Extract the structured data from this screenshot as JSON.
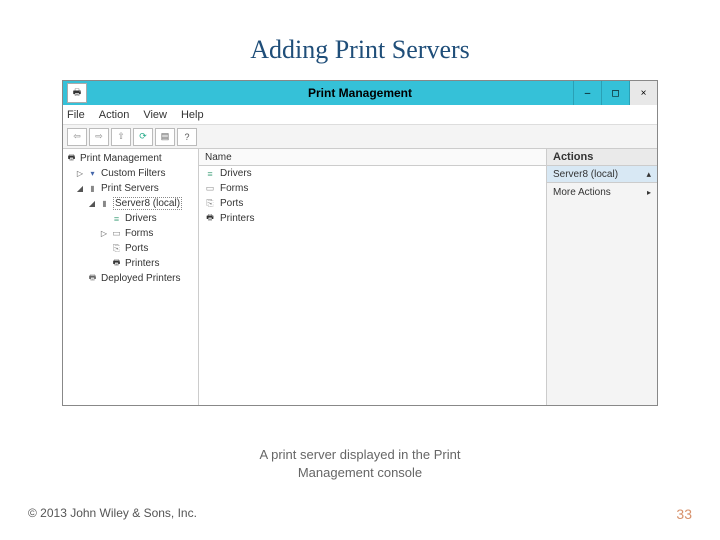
{
  "slide": {
    "title": "Adding Print Servers",
    "caption_line1": "A print server displayed in the Print",
    "caption_line2": "Management console",
    "copyright": "© 2013 John Wiley & Sons, Inc.",
    "number": "33"
  },
  "window": {
    "title": "Print Management",
    "min": "–",
    "max": "◻",
    "close": "×"
  },
  "menu": {
    "file": "File",
    "action": "Action",
    "view": "View",
    "help": "Help"
  },
  "toolbar": {
    "back": "⇦",
    "forward": "⇨",
    "up": "⇧",
    "refresh": "⟳",
    "export": "▤",
    "help": "?"
  },
  "tree": {
    "root": "Print Management",
    "custom_filters": "Custom Filters",
    "print_servers": "Print Servers",
    "server_node": "Server8 (local)",
    "drivers": "Drivers",
    "forms": "Forms",
    "ports": "Ports",
    "printers": "Printers",
    "deployed": "Deployed Printers"
  },
  "list": {
    "col_name": "Name",
    "items": {
      "drivers": "Drivers",
      "forms": "Forms",
      "ports": "Ports",
      "printers": "Printers"
    }
  },
  "actions": {
    "header": "Actions",
    "context": "Server8 (local)",
    "more": "More Actions"
  }
}
